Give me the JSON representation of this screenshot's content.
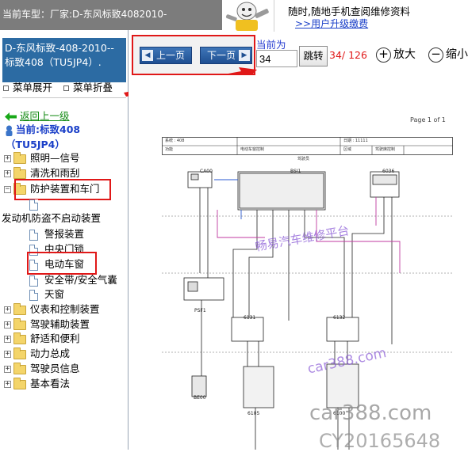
{
  "header": {
    "breadcrumb": "当前车型：厂家:D-东风标致4082010-",
    "promo_line1": "随时,随地手机查阅维修资料",
    "promo_link": ">>用户升级缴费"
  },
  "sidebar": {
    "model_line1": "D-东风标致-408-2010--",
    "model_line2": "标致408（TU5JP4）.",
    "expand_label": "菜单展开",
    "collapse_label": "菜单折叠",
    "back_label": "返回上一级",
    "current_label": "当前:标致408",
    "current_label_2": "（TU5JP4）",
    "tree": {
      "lighting": "照明—信号",
      "wash": "清洗和雨刮",
      "protection": "防护装置和车门",
      "antitheft": "发动机防盗不启动装置",
      "alarm": "警报装置",
      "central_lock": "中央门锁",
      "power_window": "电动车窗",
      "safety_belt": "安全带/安全气囊",
      "sunroof": "天窗",
      "instruments": "仪表和控制装置",
      "driver_assist": "驾驶辅助装置",
      "comfort": "舒适和便利",
      "powertrain": "动力总成",
      "driver_info": "驾驶员信息",
      "basics": "基本看法"
    }
  },
  "toolbar": {
    "prev_page": "上一页",
    "next_page": "下一页",
    "current_page_label": "当前为",
    "current_page_value": "34",
    "jump_label": "跳转",
    "page_count": "34/ 126",
    "zoom_in": "放大",
    "zoom_out": "缩小"
  },
  "document": {
    "page_of": "Page 1 of 1",
    "header_row1_c1": "系统 : 408",
    "header_row1_c2": "日期 : 11111",
    "header_row2_c1": "功能",
    "header_row2_c2": "电动车窗控制",
    "header_row2_c3": "区域",
    "header_row2_c4": "驾驶席控制",
    "header_caption": "驾驶员",
    "components": [
      "CA00",
      "BSI1",
      "6036",
      "PSF1",
      "6131",
      "6132",
      "BE00",
      "6105",
      "6100"
    ],
    "watermark_1": "畅易汽车维修平台",
    "watermark_2": "car388.com",
    "watermark_3": "car388.com",
    "watermark_4": "CY20165648"
  },
  "colors": {
    "brand_blue": "#2c6ba3",
    "highlight_red": "#e01818",
    "link_green": "#138a13",
    "watermark_purple": "#8a5ad6",
    "watermark_gray": "#8c8c8c"
  }
}
